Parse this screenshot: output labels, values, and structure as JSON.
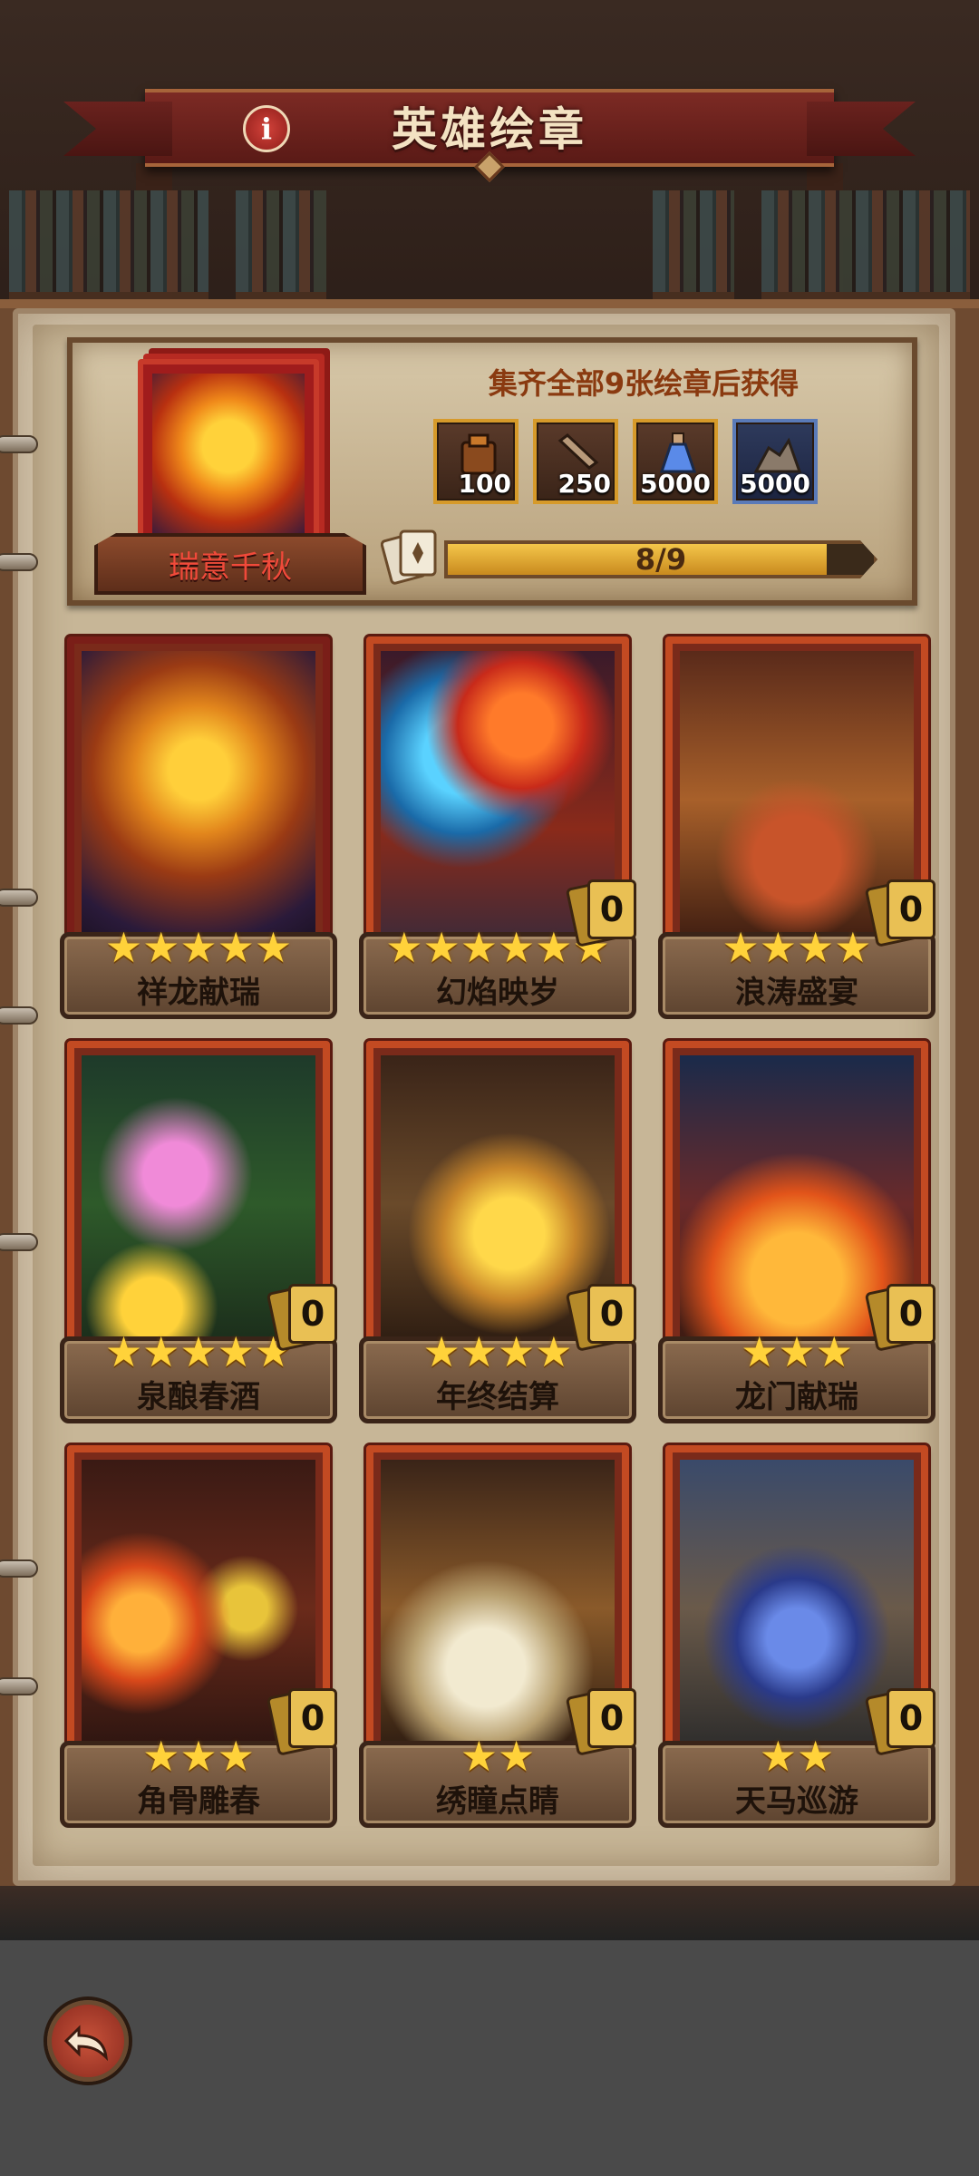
{
  "header": {
    "title": "英雄绘章",
    "info_icon": "info-icon"
  },
  "colors": {
    "accent_red": "#8e1e1a",
    "gold": "#ffd23a",
    "parchment": "#d9ccb3",
    "frame_orange": "#c34a22"
  },
  "album": {
    "name": "瑞意千秋",
    "reward_heading": "集齐全部9张绘章后获得",
    "rewards": [
      {
        "icon": "armor-crate-icon",
        "qty": "100"
      },
      {
        "icon": "scroll-icon",
        "qty": "250"
      },
      {
        "icon": "potion-icon",
        "qty": "5000"
      },
      {
        "icon": "ore-pile-icon",
        "qty": "5000"
      }
    ],
    "progress": {
      "text": "8/9",
      "fraction": 0.889
    }
  },
  "cards": [
    {
      "name": "祥龙献瑞",
      "stars": 5,
      "count": null,
      "art": "golden-dragon"
    },
    {
      "name": "幻焰映岁",
      "stars": 6,
      "count": "0",
      "art": "phoenix"
    },
    {
      "name": "浪涛盛宴",
      "stars": 4,
      "count": "0",
      "art": "feast"
    },
    {
      "name": "泉酿春酒",
      "stars": 5,
      "count": "0",
      "art": "magic-forest"
    },
    {
      "name": "年终结算",
      "stars": 4,
      "count": "0",
      "art": "treasury"
    },
    {
      "name": "龙门献瑞",
      "stars": 3,
      "count": "0",
      "art": "dragon-gate"
    },
    {
      "name": "角骨雕春",
      "stars": 3,
      "count": "0",
      "art": "fireplace"
    },
    {
      "name": "绣瞳点睛",
      "stars": 2,
      "count": "0",
      "art": "artisan"
    },
    {
      "name": "天马巡游",
      "stars": 2,
      "count": "0",
      "art": "pegasus"
    }
  ],
  "footer": {
    "back_icon": "back-arrow-icon"
  }
}
